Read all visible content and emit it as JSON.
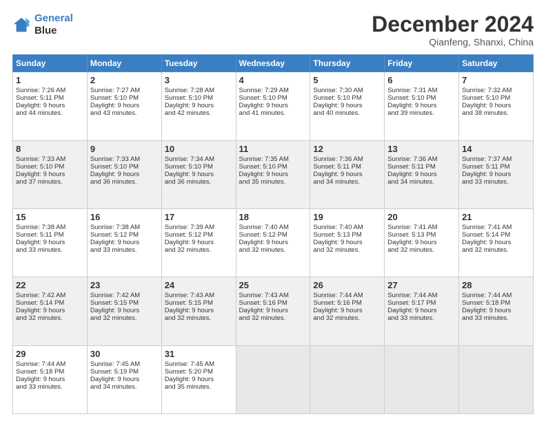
{
  "logo": {
    "line1": "General",
    "line2": "Blue"
  },
  "header": {
    "month": "December 2024",
    "location": "Qianfeng, Shanxi, China"
  },
  "weekdays": [
    "Sunday",
    "Monday",
    "Tuesday",
    "Wednesday",
    "Thursday",
    "Friday",
    "Saturday"
  ],
  "weeks": [
    [
      {
        "day": "1",
        "lines": [
          "Sunrise: 7:26 AM",
          "Sunset: 5:11 PM",
          "Daylight: 9 hours",
          "and 44 minutes."
        ]
      },
      {
        "day": "2",
        "lines": [
          "Sunrise: 7:27 AM",
          "Sunset: 5:10 PM",
          "Daylight: 9 hours",
          "and 43 minutes."
        ]
      },
      {
        "day": "3",
        "lines": [
          "Sunrise: 7:28 AM",
          "Sunset: 5:10 PM",
          "Daylight: 9 hours",
          "and 42 minutes."
        ]
      },
      {
        "day": "4",
        "lines": [
          "Sunrise: 7:29 AM",
          "Sunset: 5:10 PM",
          "Daylight: 9 hours",
          "and 41 minutes."
        ]
      },
      {
        "day": "5",
        "lines": [
          "Sunrise: 7:30 AM",
          "Sunset: 5:10 PM",
          "Daylight: 9 hours",
          "and 40 minutes."
        ]
      },
      {
        "day": "6",
        "lines": [
          "Sunrise: 7:31 AM",
          "Sunset: 5:10 PM",
          "Daylight: 9 hours",
          "and 39 minutes."
        ]
      },
      {
        "day": "7",
        "lines": [
          "Sunrise: 7:32 AM",
          "Sunset: 5:10 PM",
          "Daylight: 9 hours",
          "and 38 minutes."
        ]
      }
    ],
    [
      {
        "day": "8",
        "lines": [
          "Sunrise: 7:33 AM",
          "Sunset: 5:10 PM",
          "Daylight: 9 hours",
          "and 37 minutes."
        ]
      },
      {
        "day": "9",
        "lines": [
          "Sunrise: 7:33 AM",
          "Sunset: 5:10 PM",
          "Daylight: 9 hours",
          "and 36 minutes."
        ]
      },
      {
        "day": "10",
        "lines": [
          "Sunrise: 7:34 AM",
          "Sunset: 5:10 PM",
          "Daylight: 9 hours",
          "and 36 minutes."
        ]
      },
      {
        "day": "11",
        "lines": [
          "Sunrise: 7:35 AM",
          "Sunset: 5:10 PM",
          "Daylight: 9 hours",
          "and 35 minutes."
        ]
      },
      {
        "day": "12",
        "lines": [
          "Sunrise: 7:36 AM",
          "Sunset: 5:11 PM",
          "Daylight: 9 hours",
          "and 34 minutes."
        ]
      },
      {
        "day": "13",
        "lines": [
          "Sunrise: 7:36 AM",
          "Sunset: 5:11 PM",
          "Daylight: 9 hours",
          "and 34 minutes."
        ]
      },
      {
        "day": "14",
        "lines": [
          "Sunrise: 7:37 AM",
          "Sunset: 5:11 PM",
          "Daylight: 9 hours",
          "and 33 minutes."
        ]
      }
    ],
    [
      {
        "day": "15",
        "lines": [
          "Sunrise: 7:38 AM",
          "Sunset: 5:11 PM",
          "Daylight: 9 hours",
          "and 33 minutes."
        ]
      },
      {
        "day": "16",
        "lines": [
          "Sunrise: 7:38 AM",
          "Sunset: 5:12 PM",
          "Daylight: 9 hours",
          "and 33 minutes."
        ]
      },
      {
        "day": "17",
        "lines": [
          "Sunrise: 7:39 AM",
          "Sunset: 5:12 PM",
          "Daylight: 9 hours",
          "and 32 minutes."
        ]
      },
      {
        "day": "18",
        "lines": [
          "Sunrise: 7:40 AM",
          "Sunset: 5:12 PM",
          "Daylight: 9 hours",
          "and 32 minutes."
        ]
      },
      {
        "day": "19",
        "lines": [
          "Sunrise: 7:40 AM",
          "Sunset: 5:13 PM",
          "Daylight: 9 hours",
          "and 32 minutes."
        ]
      },
      {
        "day": "20",
        "lines": [
          "Sunrise: 7:41 AM",
          "Sunset: 5:13 PM",
          "Daylight: 9 hours",
          "and 32 minutes."
        ]
      },
      {
        "day": "21",
        "lines": [
          "Sunrise: 7:41 AM",
          "Sunset: 5:14 PM",
          "Daylight: 9 hours",
          "and 32 minutes."
        ]
      }
    ],
    [
      {
        "day": "22",
        "lines": [
          "Sunrise: 7:42 AM",
          "Sunset: 5:14 PM",
          "Daylight: 9 hours",
          "and 32 minutes."
        ]
      },
      {
        "day": "23",
        "lines": [
          "Sunrise: 7:42 AM",
          "Sunset: 5:15 PM",
          "Daylight: 9 hours",
          "and 32 minutes."
        ]
      },
      {
        "day": "24",
        "lines": [
          "Sunrise: 7:43 AM",
          "Sunset: 5:15 PM",
          "Daylight: 9 hours",
          "and 32 minutes."
        ]
      },
      {
        "day": "25",
        "lines": [
          "Sunrise: 7:43 AM",
          "Sunset: 5:16 PM",
          "Daylight: 9 hours",
          "and 32 minutes."
        ]
      },
      {
        "day": "26",
        "lines": [
          "Sunrise: 7:44 AM",
          "Sunset: 5:16 PM",
          "Daylight: 9 hours",
          "and 32 minutes."
        ]
      },
      {
        "day": "27",
        "lines": [
          "Sunrise: 7:44 AM",
          "Sunset: 5:17 PM",
          "Daylight: 9 hours",
          "and 33 minutes."
        ]
      },
      {
        "day": "28",
        "lines": [
          "Sunrise: 7:44 AM",
          "Sunset: 5:18 PM",
          "Daylight: 9 hours",
          "and 33 minutes."
        ]
      }
    ],
    [
      {
        "day": "29",
        "lines": [
          "Sunrise: 7:44 AM",
          "Sunset: 5:18 PM",
          "Daylight: 9 hours",
          "and 33 minutes."
        ]
      },
      {
        "day": "30",
        "lines": [
          "Sunrise: 7:45 AM",
          "Sunset: 5:19 PM",
          "Daylight: 9 hours",
          "and 34 minutes."
        ]
      },
      {
        "day": "31",
        "lines": [
          "Sunrise: 7:45 AM",
          "Sunset: 5:20 PM",
          "Daylight: 9 hours",
          "and 35 minutes."
        ]
      },
      null,
      null,
      null,
      null
    ]
  ]
}
